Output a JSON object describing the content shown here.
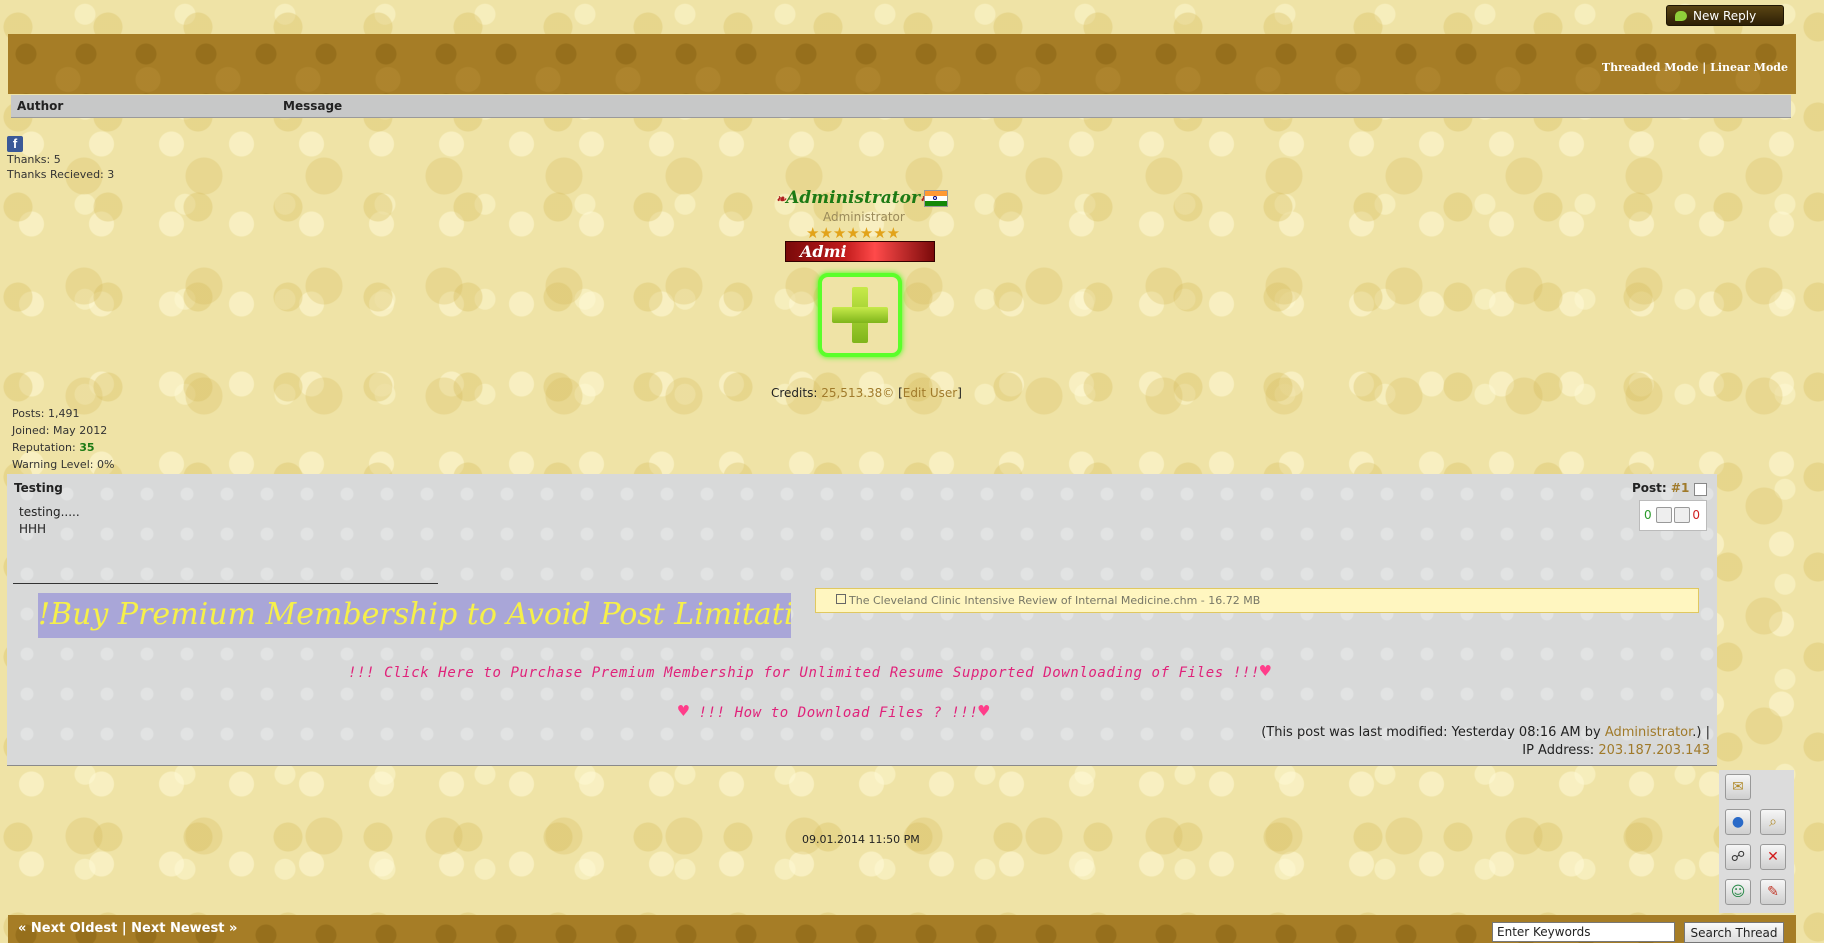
{
  "toolbar": {
    "new_reply_label": "New Reply"
  },
  "thread_header": {
    "threaded_mode_label": "Threaded Mode",
    "separator": " | ",
    "linear_mode_label": "Linear Mode"
  },
  "columns": {
    "author": "Author",
    "message": "Message"
  },
  "author": {
    "facebook_icon": "f",
    "thanks": "Thanks: 5",
    "thanks_received": "Thanks Recieved: 3",
    "username": "Administrator",
    "username_decoration": "❧",
    "usertitle": "Administrator",
    "stars": "★★★★★★★",
    "rank_label": "Admi",
    "credits_label": "Credits:",
    "credits_value": "25,513.38©",
    "edit_user_label": "Edit User",
    "posts": "Posts: 1,491",
    "joined": "Joined: May 2012",
    "reputation_label": "Reputation:",
    "reputation_value": "35",
    "warning_level": "Warning Level:  0%"
  },
  "post": {
    "subject": "Testing",
    "post_label": "Post:",
    "post_number": "#1",
    "upvotes": "0",
    "downvotes": "0",
    "body_line1": "testing.....",
    "body_line2": "HHH",
    "banner_text": "!Buy Premium Membership to Avoid Post Limitation!",
    "attachment": "The Cleveland Clinic Intensive Review of Internal Medicine.chm - 16.72 MB",
    "purchase_link": "!!! Click Here to Purchase Premium Membership for Unlimited Resume Supported Downloading of Files !!!",
    "howto_link": " !!! How to Download Files ? !!!",
    "modified_text_pre": "(This post was last modified: Yesterday 08:16 AM by ",
    "modified_by": "Administrator",
    "modified_text_post": ".) |",
    "ip_label": "IP Address:",
    "ip_value": "203.187.203.143",
    "date": "09.01.2014 11:50 PM"
  },
  "footer": {
    "next_oldest": "« Next Oldest",
    "sep": " | ",
    "next_newest": "Next Newest »",
    "search_placeholder": "Enter Keywords",
    "search_value": "Enter Keywords",
    "search_button": "Search Thread"
  },
  "colors": {
    "accent_bar": "#a67d26",
    "link": "#a07a2a",
    "promo_pink": "#e0227a",
    "banner_bg": "#a9a6d8",
    "banner_text": "#f6f04a"
  }
}
